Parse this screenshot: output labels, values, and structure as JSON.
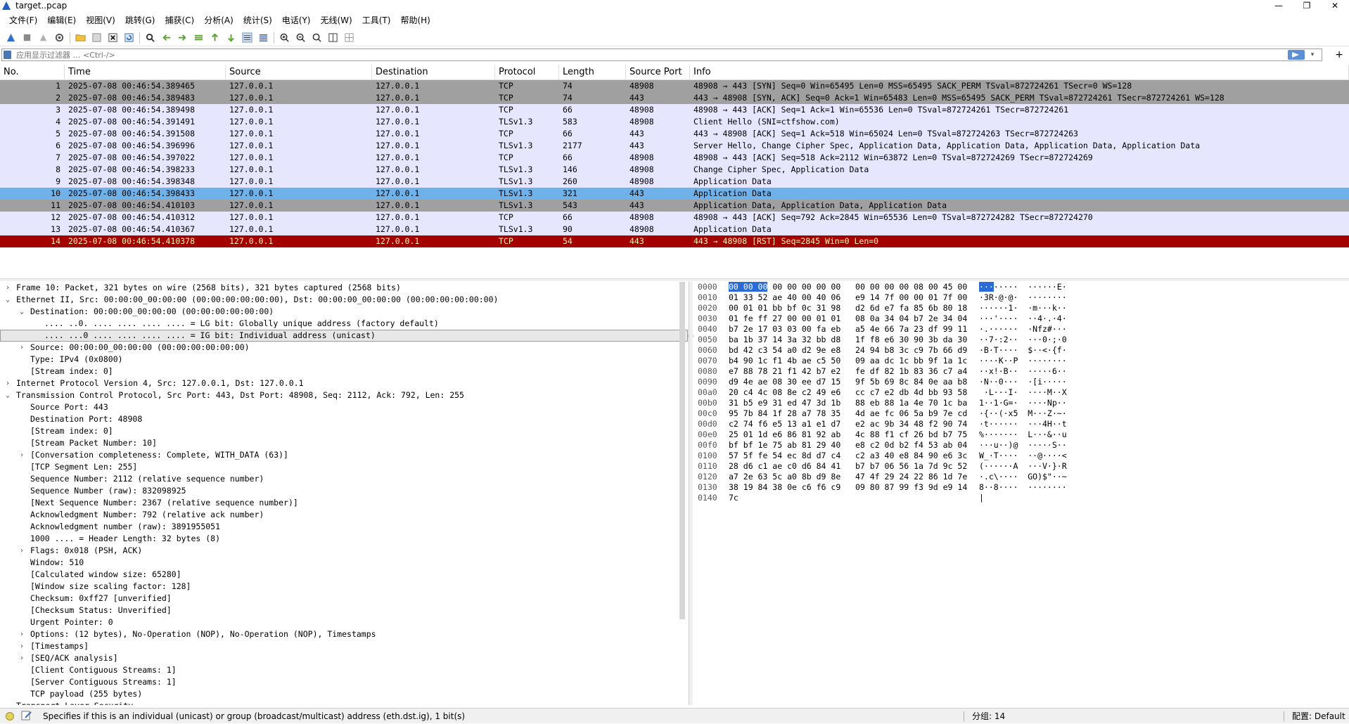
{
  "window": {
    "title": "target..pcap",
    "controls": [
      "—",
      "❐",
      "✕"
    ]
  },
  "menu": [
    "文件(F)",
    "编辑(E)",
    "视图(V)",
    "跳转(G)",
    "捕获(C)",
    "分析(A)",
    "统计(S)",
    "电话(Y)",
    "无线(W)",
    "工具(T)",
    "帮助(H)"
  ],
  "toolbar_icons": [
    "shark-fin-start-icon",
    "stop-icon",
    "restart-icon",
    "capture-options-icon",
    "open-folder-icon",
    "save-icon",
    "close-file-icon",
    "reload-icon",
    "find-icon",
    "go-back-icon",
    "go-forward-icon",
    "go-to-packet-icon",
    "first-packet-icon",
    "last-packet-icon",
    "autoscroll-icon",
    "colorize-icon",
    "zoom-in-icon",
    "zoom-out-icon",
    "zoom-reset-icon",
    "resize-columns-icon",
    "layout-icon"
  ],
  "filter": {
    "placeholder": "应用显示过滤器 … <Ctrl-/>",
    "value": ""
  },
  "packet_list": {
    "columns": [
      "No.",
      "Time",
      "Source",
      "Destination",
      "Protocol",
      "Length",
      "Source Port",
      "Info"
    ],
    "rows": [
      {
        "no": "1",
        "time": "2025-07-08 00:46:54.389465",
        "src": "127.0.0.1",
        "dst": "127.0.0.1",
        "proto": "TCP",
        "len": "74",
        "sport": "48908",
        "info": "48908 → 443 [SYN] Seq=0 Win=65495 Len=0 MSS=65495 SACK_PERM TSval=872724261 TSecr=0 WS=128",
        "style": "syn"
      },
      {
        "no": "2",
        "time": "2025-07-08 00:46:54.389483",
        "src": "127.0.0.1",
        "dst": "127.0.0.1",
        "proto": "TCP",
        "len": "74",
        "sport": "443",
        "info": "443 → 48908 [SYN, ACK] Seq=0 Ack=1 Win=65483 Len=0 MSS=65495 SACK_PERM TSval=872724261 TSecr=872724261 WS=128",
        "style": "syn"
      },
      {
        "no": "3",
        "time": "2025-07-08 00:46:54.389498",
        "src": "127.0.0.1",
        "dst": "127.0.0.1",
        "proto": "TCP",
        "len": "66",
        "sport": "48908",
        "info": "48908 → 443 [ACK] Seq=1 Ack=1 Win=65536 Len=0 TSval=872724261 TSecr=872724261",
        "style": "norm"
      },
      {
        "no": "4",
        "time": "2025-07-08 00:46:54.391491",
        "src": "127.0.0.1",
        "dst": "127.0.0.1",
        "proto": "TLSv1.3",
        "len": "583",
        "sport": "48908",
        "info": "Client Hello (SNI=ctfshow.com)",
        "style": "norm"
      },
      {
        "no": "5",
        "time": "2025-07-08 00:46:54.391508",
        "src": "127.0.0.1",
        "dst": "127.0.0.1",
        "proto": "TCP",
        "len": "66",
        "sport": "443",
        "info": "443 → 48908 [ACK] Seq=1 Ack=518 Win=65024 Len=0 TSval=872724263 TSecr=872724263",
        "style": "norm"
      },
      {
        "no": "6",
        "time": "2025-07-08 00:46:54.396996",
        "src": "127.0.0.1",
        "dst": "127.0.0.1",
        "proto": "TLSv1.3",
        "len": "2177",
        "sport": "443",
        "info": "Server Hello, Change Cipher Spec, Application Data, Application Data, Application Data, Application Data",
        "style": "norm"
      },
      {
        "no": "7",
        "time": "2025-07-08 00:46:54.397022",
        "src": "127.0.0.1",
        "dst": "127.0.0.1",
        "proto": "TCP",
        "len": "66",
        "sport": "48908",
        "info": "48908 → 443 [ACK] Seq=518 Ack=2112 Win=63872 Len=0 TSval=872724269 TSecr=872724269",
        "style": "norm"
      },
      {
        "no": "8",
        "time": "2025-07-08 00:46:54.398233",
        "src": "127.0.0.1",
        "dst": "127.0.0.1",
        "proto": "TLSv1.3",
        "len": "146",
        "sport": "48908",
        "info": "Change Cipher Spec, Application Data",
        "style": "norm"
      },
      {
        "no": "9",
        "time": "2025-07-08 00:46:54.398348",
        "src": "127.0.0.1",
        "dst": "127.0.0.1",
        "proto": "TLSv1.3",
        "len": "260",
        "sport": "48908",
        "info": "Application Data",
        "style": "norm"
      },
      {
        "no": "10",
        "time": "2025-07-08 00:46:54.398433",
        "src": "127.0.0.1",
        "dst": "127.0.0.1",
        "proto": "TLSv1.3",
        "len": "321",
        "sport": "443",
        "info": "Application Data",
        "style": "sel"
      },
      {
        "no": "11",
        "time": "2025-07-08 00:46:54.410103",
        "src": "127.0.0.1",
        "dst": "127.0.0.1",
        "proto": "TLSv1.3",
        "len": "543",
        "sport": "443",
        "info": "Application Data, Application Data, Application Data",
        "style": "syn"
      },
      {
        "no": "12",
        "time": "2025-07-08 00:46:54.410312",
        "src": "127.0.0.1",
        "dst": "127.0.0.1",
        "proto": "TCP",
        "len": "66",
        "sport": "48908",
        "info": "48908 → 443 [ACK] Seq=792 Ack=2845 Win=65536 Len=0 TSval=872724282 TSecr=872724270",
        "style": "norm"
      },
      {
        "no": "13",
        "time": "2025-07-08 00:46:54.410367",
        "src": "127.0.0.1",
        "dst": "127.0.0.1",
        "proto": "TLSv1.3",
        "len": "90",
        "sport": "48908",
        "info": "Application Data",
        "style": "norm"
      },
      {
        "no": "14",
        "time": "2025-07-08 00:46:54.410378",
        "src": "127.0.0.1",
        "dst": "127.0.0.1",
        "proto": "TCP",
        "len": "54",
        "sport": "443",
        "info": "443 → 48908 [RST] Seq=2845 Win=0 Len=0",
        "style": "rst"
      }
    ]
  },
  "details": [
    {
      "indent": 0,
      "arrow": ">",
      "text": "Frame 10: Packet, 321 bytes on wire (2568 bits), 321 bytes captured (2568 bits)"
    },
    {
      "indent": 0,
      "arrow": "v",
      "text": "Ethernet II, Src: 00:00:00_00:00:00 (00:00:00:00:00:00), Dst: 00:00:00_00:00:00 (00:00:00:00:00:00)"
    },
    {
      "indent": 1,
      "arrow": "v",
      "text": "Destination: 00:00:00_00:00:00 (00:00:00:00:00:00)"
    },
    {
      "indent": 2,
      "arrow": "",
      "text": ".... ..0. .... .... .... .... = LG bit: Globally unique address (factory default)"
    },
    {
      "indent": 2,
      "arrow": "",
      "text": ".... ...0 .... .... .... .... = IG bit: Individual address (unicast)",
      "selected": true
    },
    {
      "indent": 1,
      "arrow": ">",
      "text": "Source: 00:00:00_00:00:00 (00:00:00:00:00:00)"
    },
    {
      "indent": 1,
      "arrow": "",
      "text": "Type: IPv4 (0x0800)"
    },
    {
      "indent": 1,
      "arrow": "",
      "text": "[Stream index: 0]"
    },
    {
      "indent": 0,
      "arrow": ">",
      "text": "Internet Protocol Version 4, Src: 127.0.0.1, Dst: 127.0.0.1"
    },
    {
      "indent": 0,
      "arrow": "v",
      "text": "Transmission Control Protocol, Src Port: 443, Dst Port: 48908, Seq: 2112, Ack: 792, Len: 255"
    },
    {
      "indent": 1,
      "arrow": "",
      "text": "Source Port: 443"
    },
    {
      "indent": 1,
      "arrow": "",
      "text": "Destination Port: 48908"
    },
    {
      "indent": 1,
      "arrow": "",
      "text": "[Stream index: 0]"
    },
    {
      "indent": 1,
      "arrow": "",
      "text": "[Stream Packet Number: 10]"
    },
    {
      "indent": 1,
      "arrow": ">",
      "text": "[Conversation completeness: Complete, WITH_DATA (63)]"
    },
    {
      "indent": 1,
      "arrow": "",
      "text": "[TCP Segment Len: 255]"
    },
    {
      "indent": 1,
      "arrow": "",
      "text": "Sequence Number: 2112    (relative sequence number)"
    },
    {
      "indent": 1,
      "arrow": "",
      "text": "Sequence Number (raw): 832098925"
    },
    {
      "indent": 1,
      "arrow": "",
      "text": "[Next Sequence Number: 2367    (relative sequence number)]"
    },
    {
      "indent": 1,
      "arrow": "",
      "text": "Acknowledgment Number: 792    (relative ack number)"
    },
    {
      "indent": 1,
      "arrow": "",
      "text": "Acknowledgment number (raw): 3891955051"
    },
    {
      "indent": 1,
      "arrow": "",
      "text": "1000 .... = Header Length: 32 bytes (8)"
    },
    {
      "indent": 1,
      "arrow": ">",
      "text": "Flags: 0x018 (PSH, ACK)"
    },
    {
      "indent": 1,
      "arrow": "",
      "text": "Window: 510"
    },
    {
      "indent": 1,
      "arrow": "",
      "text": "[Calculated window size: 65280]"
    },
    {
      "indent": 1,
      "arrow": "",
      "text": "[Window size scaling factor: 128]"
    },
    {
      "indent": 1,
      "arrow": "",
      "text": "Checksum: 0xff27 [unverified]"
    },
    {
      "indent": 1,
      "arrow": "",
      "text": "[Checksum Status: Unverified]"
    },
    {
      "indent": 1,
      "arrow": "",
      "text": "Urgent Pointer: 0"
    },
    {
      "indent": 1,
      "arrow": ">",
      "text": "Options: (12 bytes), No-Operation (NOP), No-Operation (NOP), Timestamps"
    },
    {
      "indent": 1,
      "arrow": ">",
      "text": "[Timestamps]"
    },
    {
      "indent": 1,
      "arrow": ">",
      "text": "[SEQ/ACK analysis]"
    },
    {
      "indent": 1,
      "arrow": "",
      "text": "[Client Contiguous Streams: 1]"
    },
    {
      "indent": 1,
      "arrow": "",
      "text": "[Server Contiguous Streams: 1]"
    },
    {
      "indent": 1,
      "arrow": "",
      "text": "TCP payload (255 bytes)"
    },
    {
      "indent": 0,
      "arrow": "v",
      "text": "Transport Layer Security"
    }
  ],
  "bytes": [
    {
      "off": "0000",
      "hex_hl": "00 00 00",
      "hex": " 00 00 00 00 00   00 00 00 00 08 00 45 00",
      "asc_hl": "···",
      "asc": "·····  ······E·"
    },
    {
      "off": "0010",
      "hex": "01 33 52 ae 40 00 40 06   e9 14 7f 00 00 01 7f 00",
      "asc": "·3R·@·@·  ········"
    },
    {
      "off": "0020",
      "hex": "00 01 01 bb bf 0c 31 98   d2 6d e7 fa 85 6b 80 18",
      "asc": "······1·  ·m···k··"
    },
    {
      "off": "0030",
      "hex": "01 fe ff 27 00 00 01 01   08 0a 34 04 b7 2e 34 04",
      "asc": "···'····  ··4·.·4·"
    },
    {
      "off": "0040",
      "hex": "b7 2e 17 03 03 00 fa eb   a5 4e 66 7a 23 df 99 11",
      "asc": "·.······  ·Nfz#···"
    },
    {
      "off": "0050",
      "hex": "ba 1b 37 14 3a 32 bb d8   1f f8 e6 30 90 3b da 30",
      "asc": "··7·:2··  ···0·;·0"
    },
    {
      "off": "0060",
      "hex": "bd 42 c3 54 a0 d2 9e e8   24 94 b8 3c c9 7b 66 d9",
      "asc": "·B·T····  $··<·{f·"
    },
    {
      "off": "0070",
      "hex": "b4 90 1c f1 4b ae c5 50   09 aa dc 1c bb 9f 1a 1c",
      "asc": "····K··P  ········"
    },
    {
      "off": "0080",
      "hex": "e7 88 78 21 f1 42 b7 e2   fe df 82 1b 83 36 c7 a4",
      "asc": "··x!·B··  ·····6··"
    },
    {
      "off": "0090",
      "hex": "d9 4e ae 08 30 ee d7 15   9f 5b 69 8c 84 0e aa b8",
      "asc": "·N··0···  ·[i·····"
    },
    {
      "off": "00a0",
      "hex": "20 c4 4c 08 8e c2 49 e6   cc c7 e2 db 4d bb 93 58",
      "asc": " ·L···I·  ····M··X"
    },
    {
      "off": "00b0",
      "hex": "31 b5 e9 31 ed 47 3d 1b   88 eb 88 1a 4e 70 1c ba",
      "asc": "1··1·G=·  ····Np··"
    },
    {
      "off": "00c0",
      "hex": "95 7b 84 1f 28 a7 78 35   4d ae fc 06 5a b9 7e cd",
      "asc": "·{··(·x5  M···Z·~·"
    },
    {
      "off": "00d0",
      "hex": "c2 74 f6 e5 13 a1 e1 d7   e2 ac 9b 34 48 f2 90 74",
      "asc": "·t······  ···4H··t"
    },
    {
      "off": "00e0",
      "hex": "25 01 1d e6 86 81 92 ab   4c 88 f1 cf 26 bd b7 75",
      "asc": "%·······  L···&··u"
    },
    {
      "off": "00f0",
      "hex": "bf bf 1e 75 ab 81 29 40   e8 c2 0d b2 f4 53 ab 04",
      "asc": "···u··)@  ·····S··"
    },
    {
      "off": "0100",
      "hex": "57 5f fe 54 ec 8d d7 c4   c2 a3 40 e8 84 90 e6 3c",
      "asc": "W_·T····  ··@····<"
    },
    {
      "off": "0110",
      "hex": "28 d6 c1 ae c0 d6 84 41   b7 b7 06 56 1a 7d 9c 52",
      "asc": "(······A  ···V·}·R"
    },
    {
      "off": "0120",
      "hex": "a7 2e 63 5c a0 8b d9 8e   47 4f 29 24 22 86 1d 7e",
      "asc": "·.c\\····  GO)$\"··~"
    },
    {
      "off": "0130",
      "hex": "38 19 84 38 0e c6 f6 c9   09 80 87 99 f3 9d e9 14",
      "asc": "8··8····  ········"
    },
    {
      "off": "0140",
      "hex": "7c",
      "asc": "|"
    }
  ],
  "status": {
    "message": "Specifies if this is an individual (unicast) or group (broadcast/multicast) address (eth.dst.ig), 1 bit(s)",
    "packets": "分组: 14",
    "profile": "配置: Default"
  }
}
